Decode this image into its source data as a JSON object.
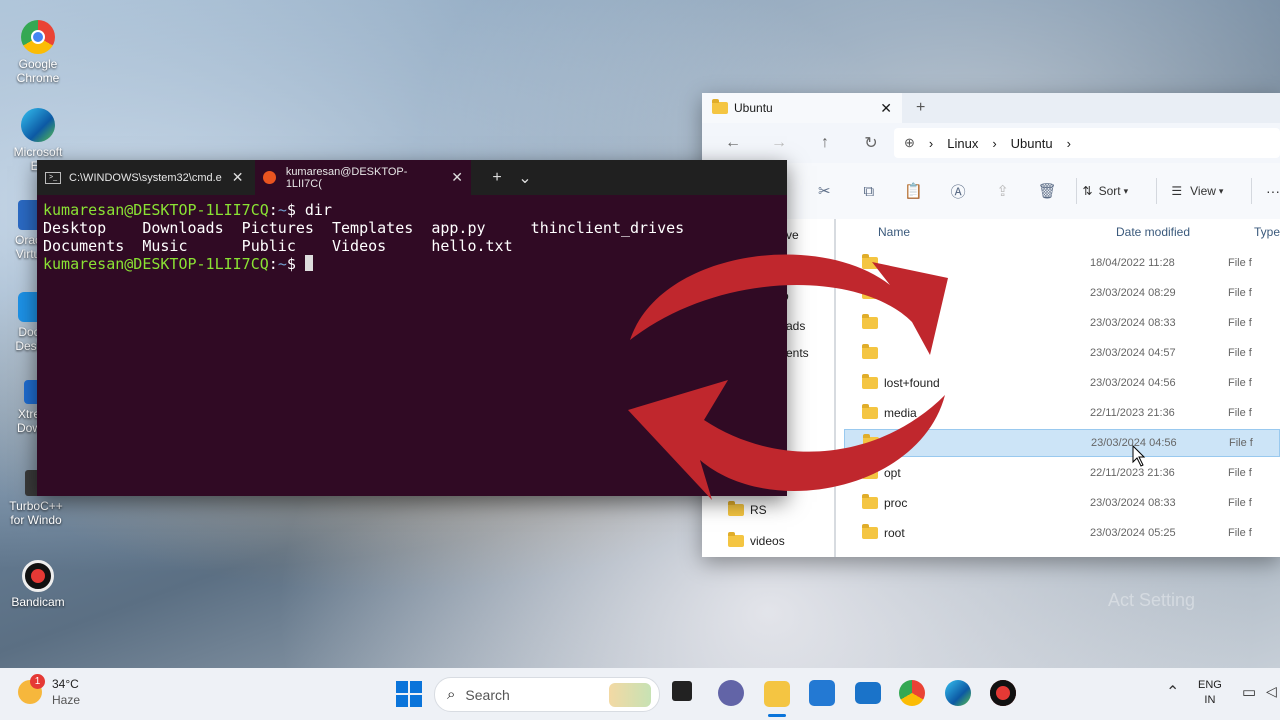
{
  "desktop": {
    "icons": [
      {
        "label": "Google Chrome"
      },
      {
        "label": "Microsoft Ed"
      },
      {
        "label": "Orac Virtu"
      },
      {
        "label": "Doc Desk"
      },
      {
        "label": "Xtre Dow"
      },
      {
        "label": "TurboC++ for Windo"
      },
      {
        "label": "Bandicam"
      }
    ],
    "watermark": "Act    Setting"
  },
  "terminal": {
    "tab1": "C:\\WINDOWS\\system32\\cmd.e",
    "tab2": "kumaresan@DESKTOP-1LII7C(",
    "new_tab": "+",
    "dropdown": "⌄",
    "prompt_user": "kumaresan@DESKTOP-1LII7CQ",
    "prompt_path": "~",
    "command": "dir",
    "line1": "Desktop    Downloads  Pictures  Templates  app.py     thinclient_drives",
    "line2": "Documents  Music      Public    Videos     hello.txt"
  },
  "explorer": {
    "tab_title": "Ubuntu",
    "tab_add": "+",
    "address": [
      "Linux",
      "Ubuntu"
    ],
    "sort": "Sort",
    "view": "View",
    "more": "···",
    "columns": {
      "name": "Name",
      "date": "Date modified",
      "type": "Type"
    },
    "nav_items": [
      {
        "label": "ve"
      },
      {
        "label": "o"
      },
      {
        "label": "ads"
      },
      {
        "label": "ents"
      },
      {
        "label": "RS"
      },
      {
        "label": "videos"
      }
    ],
    "rows": [
      {
        "name": "",
        "date": "18/04/2022 11:28",
        "type": "File f"
      },
      {
        "name": "",
        "date": "23/03/2024 08:29",
        "type": "File f"
      },
      {
        "name": "",
        "date": "23/03/2024 08:33",
        "type": "File f"
      },
      {
        "name": "",
        "date": "23/03/2024 04:57",
        "type": "File f"
      },
      {
        "name": "lost+found",
        "date": "23/03/2024 04:56",
        "type": "File f"
      },
      {
        "name": "media",
        "date": "22/11/2023 21:36",
        "type": "File f"
      },
      {
        "name": "",
        "date": "23/03/2024 04:56",
        "type": "File f"
      },
      {
        "name": "opt",
        "date": "22/11/2023 21:36",
        "type": "File f"
      },
      {
        "name": "proc",
        "date": "23/03/2024 08:33",
        "type": "File f"
      },
      {
        "name": "root",
        "date": "23/03/2024 05:25",
        "type": "File f"
      }
    ],
    "selected_index": 6
  },
  "taskbar": {
    "weather_temp": "34°C",
    "weather_desc": "Haze",
    "weather_badge": "1",
    "search_placeholder": "Search",
    "lang_top": "ENG",
    "lang_bottom": "IN"
  },
  "colors": {
    "terminal_bg": "#300a24",
    "prompt_green": "#8ae234",
    "prompt_blue": "#729fcf",
    "arrow_red": "#c0272d"
  }
}
